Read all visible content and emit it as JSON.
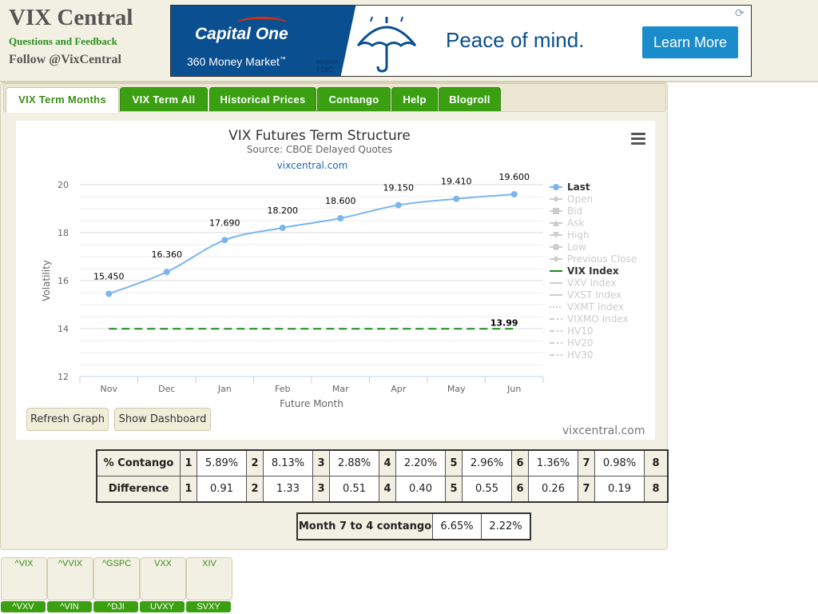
{
  "site": {
    "title": "VIX Central",
    "feedback": "Questions and Feedback",
    "follow": "Follow @VixCentral"
  },
  "ad": {
    "brand": "Capital One",
    "product": "360 Money Market",
    "product_mark": "™",
    "fdic_line1": "MEMBER",
    "fdic_line2": "FDIC",
    "headline": "Peace of mind.",
    "cta": "Learn More",
    "icons": [
      "umbrella-icon",
      "refresh-icon"
    ],
    "colors": {
      "brand_blue": "#0a4f8f",
      "cta": "#1a8ccb",
      "swoosh": "#d22e1e"
    }
  },
  "tabs": [
    {
      "label": "VIX Term Months",
      "active": true
    },
    {
      "label": "VIX Term All",
      "active": false
    },
    {
      "label": "Historical Prices",
      "active": false
    },
    {
      "label": "Contango",
      "active": false
    },
    {
      "label": "Help",
      "active": false
    },
    {
      "label": "Blogroll",
      "active": false
    }
  ],
  "chart_data": {
    "type": "line",
    "title": "VIX Futures Term Structure",
    "subtitle": "Source: CBOE Delayed Quotes",
    "credit_link": "vixcentral.com",
    "xlabel": "Future Month",
    "ylabel": "Volatility",
    "categories": [
      "Nov",
      "Dec",
      "Jan",
      "Feb",
      "Mar",
      "Apr",
      "May",
      "Jun"
    ],
    "ylim": [
      12,
      20
    ],
    "yticks": [
      12,
      14,
      16,
      18,
      20
    ],
    "grid": true,
    "legend_position": "right",
    "series": [
      {
        "name": "Last",
        "values": [
          15.45,
          16.36,
          17.69,
          18.2,
          18.6,
          19.15,
          19.41,
          19.6
        ],
        "labels": [
          "15.450",
          "16.360",
          "17.690",
          "18.200",
          "18.600",
          "19.150",
          "19.410",
          "19.600"
        ],
        "color": "#7cb5ec",
        "style": "solid"
      },
      {
        "name": "VIX Index",
        "values": [
          13.99,
          13.99,
          13.99,
          13.99,
          13.99,
          13.99,
          13.99,
          13.99
        ],
        "end_label": "13.99",
        "color": "#1a8a1a",
        "style": "dashed"
      }
    ],
    "legend": [
      {
        "name": "Last",
        "active": true,
        "marker": "circle",
        "line": "solid"
      },
      {
        "name": "Open",
        "active": false,
        "marker": "diamond",
        "line": "solid"
      },
      {
        "name": "Bid",
        "active": false,
        "marker": "square",
        "line": "solid"
      },
      {
        "name": "Ask",
        "active": false,
        "marker": "triangle",
        "line": "solid"
      },
      {
        "name": "High",
        "active": false,
        "marker": "triangle-down",
        "line": "solid"
      },
      {
        "name": "Low",
        "active": false,
        "marker": "circle",
        "line": "solid"
      },
      {
        "name": "Previous Close",
        "active": false,
        "marker": "diamond",
        "line": "solid"
      },
      {
        "name": "VIX Index",
        "active": true,
        "marker": "none",
        "line": "solid",
        "color": "#1a8a1a"
      },
      {
        "name": "VXV Index",
        "active": false,
        "marker": "none",
        "line": "solid"
      },
      {
        "name": "VXST Index",
        "active": false,
        "marker": "none",
        "line": "solid"
      },
      {
        "name": "VXMT Index",
        "active": false,
        "marker": "none",
        "line": "dotted"
      },
      {
        "name": "VIXMO Index",
        "active": false,
        "marker": "none",
        "line": "dashdot"
      },
      {
        "name": "HV10",
        "active": false,
        "marker": "none",
        "line": "dashdot"
      },
      {
        "name": "HV20",
        "active": false,
        "marker": "none",
        "line": "dashdot"
      },
      {
        "name": "HV30",
        "active": false,
        "marker": "none",
        "line": "dashdot"
      }
    ]
  },
  "buttons": {
    "refresh": "Refresh Graph",
    "dashboard": "Show Dashboard"
  },
  "credit": "vixcentral.com",
  "contango_table": {
    "rows": [
      {
        "label": "% Contango",
        "cells": [
          [
            "1",
            "5.89%"
          ],
          [
            "2",
            "8.13%"
          ],
          [
            "3",
            "2.88%"
          ],
          [
            "4",
            "2.20%"
          ],
          [
            "5",
            "2.96%"
          ],
          [
            "6",
            "1.36%"
          ],
          [
            "7",
            "0.98%"
          ]
        ],
        "last": "8"
      },
      {
        "label": "Difference",
        "cells": [
          [
            "1",
            "0.91"
          ],
          [
            "2",
            "1.33"
          ],
          [
            "3",
            "0.51"
          ],
          [
            "4",
            "0.40"
          ],
          [
            "5",
            "0.55"
          ],
          [
            "6",
            "0.26"
          ],
          [
            "7",
            "0.19"
          ]
        ],
        "last": "8"
      }
    ]
  },
  "month74": {
    "label": "Month 7 to 4 contango",
    "v1": "6.65%",
    "v2": "2.22%"
  },
  "tickers": [
    {
      "top": "^VIX",
      "bottom": "^VXV"
    },
    {
      "top": "^VVIX",
      "bottom": "^VIN"
    },
    {
      "top": "^GSPC",
      "bottom": "^DJI"
    },
    {
      "top": "VXX",
      "bottom": "UVXY"
    },
    {
      "top": "XIV",
      "bottom": "SVXY"
    }
  ]
}
